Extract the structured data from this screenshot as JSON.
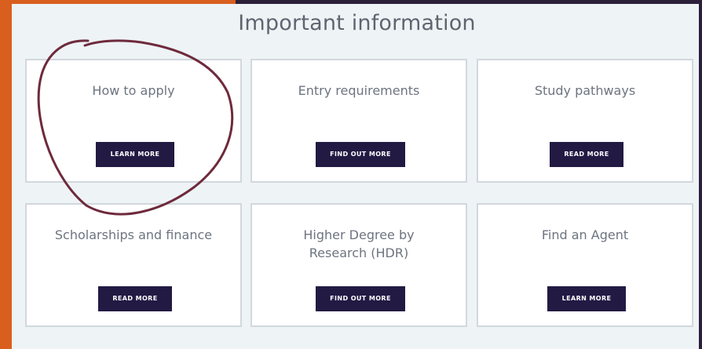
{
  "page": {
    "title": "Important information"
  },
  "cards": [
    {
      "title": "How to apply",
      "button": "LEARN MORE"
    },
    {
      "title": "Entry requirements",
      "button": "FIND OUT MORE"
    },
    {
      "title": "Study pathways",
      "button": "READ MORE"
    },
    {
      "title": "Scholarships and finance",
      "button": "READ MORE"
    },
    {
      "title": "Higher Degree by Research (HDR)",
      "button": "FIND OUT MORE"
    },
    {
      "title": "Find an Agent",
      "button": "LEARN MORE"
    }
  ],
  "colors": {
    "accent_orange": "#d95f1e",
    "button_navy": "#231a44",
    "annotation_maroon": "#6e2a3c"
  }
}
